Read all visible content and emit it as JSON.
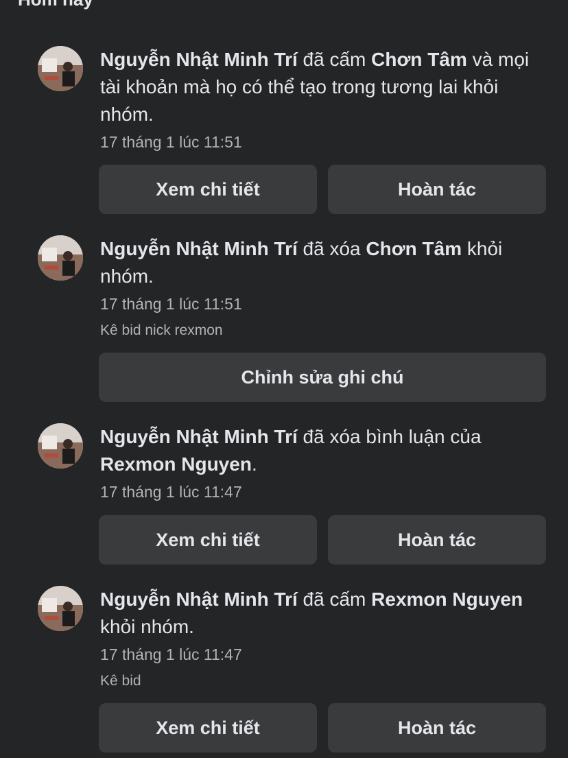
{
  "section_title": "Hôm nay",
  "entries": [
    {
      "actor": "Nguyễn Nhật Minh Trí",
      "action": " đã cấm ",
      "target": "Chơn Tâm",
      "suffix": " và mọi tài khoản mà họ có thể tạo trong tương lai khỏi nhóm.",
      "time": "17 tháng 1 lúc 11:51",
      "buttons": [
        "Xem chi tiết",
        "Hoàn tác"
      ]
    },
    {
      "actor": "Nguyễn Nhật Minh Trí",
      "action": " đã xóa ",
      "target": "Chơn Tâm",
      "suffix": " khỏi nhóm.",
      "time": "17 tháng 1 lúc 11:51",
      "note": "Kê bid nick rexmon",
      "buttons": [
        "Chỉnh sửa ghi chú"
      ]
    },
    {
      "actor": "Nguyễn Nhật Minh Trí",
      "action": " đã xóa bình luận của ",
      "target": "Rexmon Nguyen",
      "suffix": ".",
      "time": "17 tháng 1 lúc 11:47",
      "buttons": [
        "Xem chi tiết",
        "Hoàn tác"
      ]
    },
    {
      "actor": "Nguyễn Nhật Minh Trí",
      "action": " đã cấm ",
      "target": "Rexmon Nguyen",
      "suffix": " khỏi nhóm.",
      "time": "17 tháng 1 lúc 11:47",
      "note": "Kê bid",
      "buttons": [
        "Xem chi tiết",
        "Hoàn tác"
      ]
    }
  ]
}
